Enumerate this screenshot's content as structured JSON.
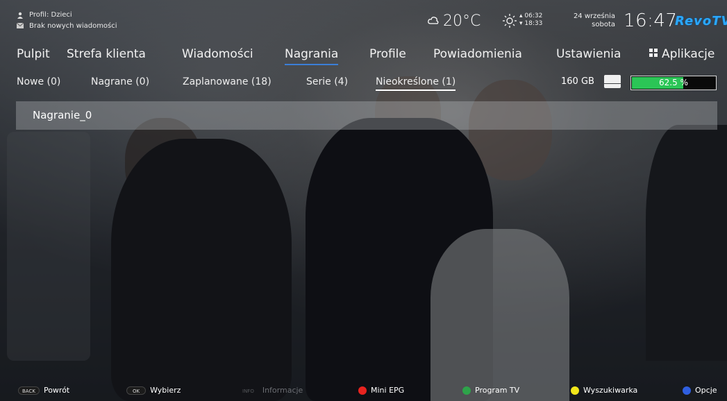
{
  "status": {
    "profile": "Profil: Dzieci",
    "messages": "Brak nowych wiadomości",
    "temperature": "20°C",
    "sunrise": "06:32",
    "sunset": "18:33",
    "date": "24 września",
    "weekday": "sobota",
    "time": "16:47",
    "logo": "RevoTV"
  },
  "mainmenu": [
    {
      "label": "Pulpit"
    },
    {
      "label": "Strefa klienta"
    },
    {
      "label": "Wiadomości"
    },
    {
      "label": "Nagrania",
      "active": true
    },
    {
      "label": "Profile"
    },
    {
      "label": "Powiadomienia"
    },
    {
      "label": "Ustawienia"
    },
    {
      "label": "Aplikacje"
    }
  ],
  "submenu": [
    {
      "label": "Nowe (0)"
    },
    {
      "label": "Nagrane (0)"
    },
    {
      "label": "Zaplanowane (18)"
    },
    {
      "label": "Serie (4)"
    },
    {
      "label": "Nieokreślone (1)",
      "active": true
    }
  ],
  "storage": {
    "size": "160 GB",
    "used_percent": 62.5,
    "used_label": "62.5 %",
    "fill_color": "#2bc556"
  },
  "recordings": [
    {
      "name": "Nagranie_0"
    }
  ],
  "footer": {
    "back_key": "BACK",
    "back_label": "Powrót",
    "ok_key": "OK",
    "ok_label": "Wybierz",
    "info_key": "INFO",
    "info_label": "Informacje",
    "red_label": "Mini EPG",
    "green_label": "Program TV",
    "yellow_label": "Wyszukiwarka",
    "blue_label": "Opcje",
    "red_color": "#e8231f",
    "green_color": "#2ea34a",
    "yellow_color": "#f2e61a",
    "blue_color": "#2f5fe0"
  }
}
